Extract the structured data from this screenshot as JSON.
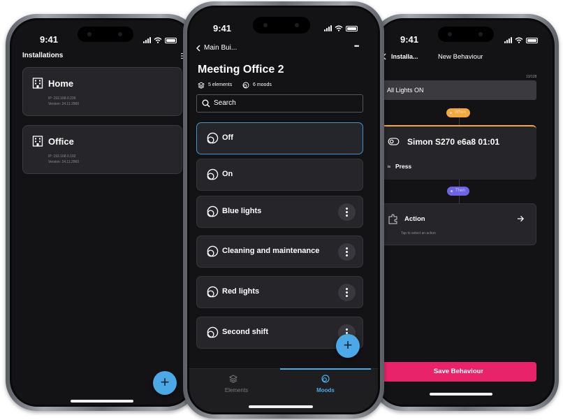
{
  "status": {
    "time": "9:41"
  },
  "installations": {
    "title": "Installations",
    "items": [
      {
        "name": "Home",
        "ip": "IP: 192.168.0.236",
        "version": "Version: 24.11.2960"
      },
      {
        "name": "Office",
        "ip": "IP: 192.168.0.192",
        "version": "Version: 24.11.2960"
      }
    ],
    "fab_label": "+"
  },
  "moods_screen": {
    "back_label": "Main Bui...",
    "menu_label": "•••",
    "title": "Meeting Office 2",
    "elements_count": "5 elements",
    "moods_count": "6 moods",
    "search_placeholder": "Search",
    "moods": [
      {
        "label": "Off",
        "selected": true,
        "has_menu": false
      },
      {
        "label": "On",
        "selected": false,
        "has_menu": false
      },
      {
        "label": "Blue lights",
        "selected": false,
        "has_menu": true
      },
      {
        "label": "Cleaning and maintenance",
        "selected": false,
        "has_menu": true
      },
      {
        "label": "Red lights",
        "selected": false,
        "has_menu": true
      },
      {
        "label": "Second shift",
        "selected": false,
        "has_menu": true
      }
    ],
    "fab_label": "+",
    "tabs": [
      {
        "label": "Elements",
        "active": false
      },
      {
        "label": "Moods",
        "active": true
      }
    ],
    "accent": "#4aa9e6"
  },
  "behaviour_screen": {
    "back_label": "Installa...",
    "title": "New Behaviour",
    "char_count": "13/128",
    "name_value": "All Lights ON",
    "when_label": "When",
    "device_name": "Simon S270 e6a8 01:01",
    "condition_is": "is",
    "condition_value": "Press",
    "then_label": "Then",
    "action_title": "Action",
    "action_hint": "Tap to select an action",
    "save_label": "Save Behaviour",
    "when_color": "#f4a93a",
    "then_color": "#6f63e8",
    "save_color": "#e8236a"
  }
}
